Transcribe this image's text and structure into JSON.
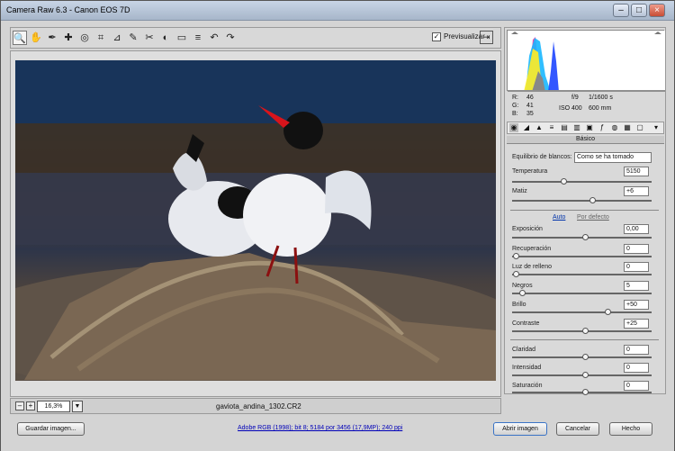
{
  "window": {
    "title": "Camera Raw 6.3  -  Canon EOS 7D",
    "minimize": "–",
    "maximize": "□",
    "close": "×"
  },
  "toolbar": {
    "preview_label": "Previsualizar",
    "preview_checked": "✓",
    "tools": [
      "🔍",
      "✋",
      "✒",
      "✚",
      "◎",
      "⌗",
      "⊿",
      "✎",
      "✂",
      "◐",
      "▭",
      "≡",
      "↶",
      "↷"
    ],
    "fullscreen_icon": "⇥"
  },
  "image": {
    "zoom": "16,3%",
    "filename": "gaviota_andina_1302.CR2",
    "zoom_out": "–",
    "zoom_in": "+",
    "zoom_drop": "▼"
  },
  "readouts": {
    "r_label": "R:",
    "r": "46",
    "g_label": "G:",
    "g": "41",
    "b_label": "B:",
    "b": "35",
    "aperture": "f/9",
    "shutter": "1/1600 s",
    "iso": "ISO 400",
    "focal": "600 mm"
  },
  "panel": {
    "title": "Básico",
    "wb_label": "Equilibrio de blancos:",
    "wb_value": "Como se ha tomado",
    "auto": "Auto",
    "default": "Por defecto",
    "controls": [
      {
        "label": "Temperatura",
        "value": "5150"
      },
      {
        "label": "Matiz",
        "value": "+6"
      },
      {
        "label": "Exposición",
        "value": "0,00"
      },
      {
        "label": "Recuperación",
        "value": "0"
      },
      {
        "label": "Luz de relleno",
        "value": "0"
      },
      {
        "label": "Negros",
        "value": "5"
      },
      {
        "label": "Brillo",
        "value": "+50"
      },
      {
        "label": "Contraste",
        "value": "+25"
      },
      {
        "label": "Claridad",
        "value": "0"
      },
      {
        "label": "Intensidad",
        "value": "0"
      },
      {
        "label": "Saturación",
        "value": "0"
      }
    ]
  },
  "bottom": {
    "save": "Guardar imagen...",
    "workflow": "Adobe RGB (1998); bit 8; 5184 por 3456 (17,9MP); 240 ppi",
    "open": "Abrir imagen",
    "cancel": "Cancelar",
    "done": "Hecho"
  },
  "colors": {
    "accent": "#0000b8",
    "photo_blue": "#1b3355",
    "beak": "#d8141b"
  }
}
